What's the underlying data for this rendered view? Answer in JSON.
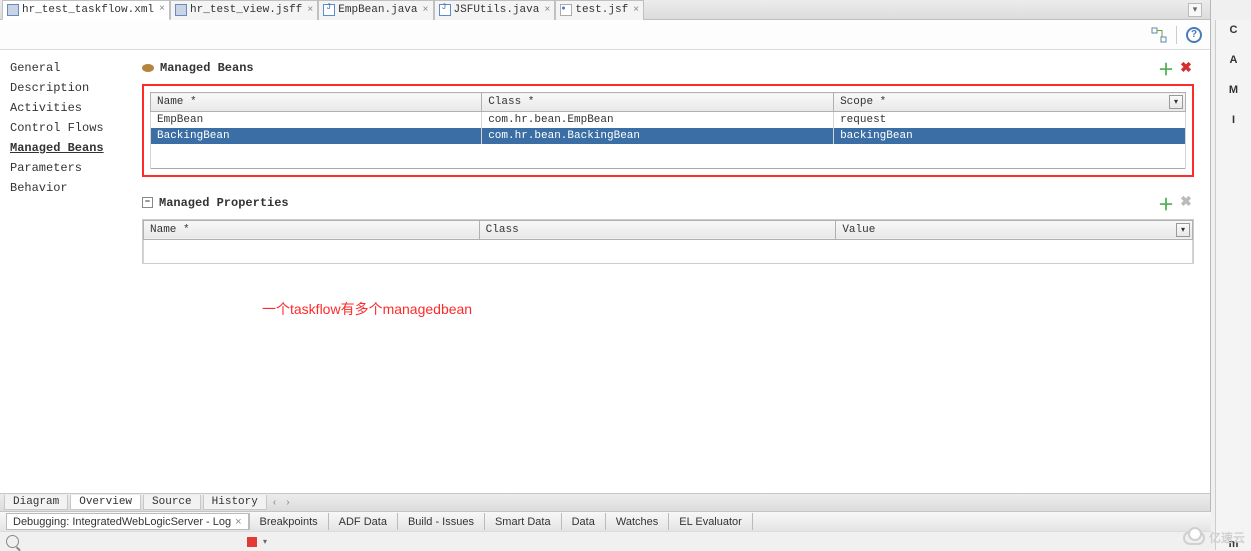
{
  "editorTabs": [
    {
      "label": "hr_test_taskflow.xml",
      "type": "xml",
      "active": true
    },
    {
      "label": "hr_test_view.jsff",
      "type": "xml",
      "active": false
    },
    {
      "label": "EmpBean.java",
      "type": "java",
      "active": false
    },
    {
      "label": "JSFUtils.java",
      "type": "java",
      "active": false
    },
    {
      "label": "test.jsf",
      "type": "jsf",
      "active": false
    }
  ],
  "sidebar": {
    "items": [
      {
        "label": "General"
      },
      {
        "label": "Description"
      },
      {
        "label": "Activities"
      },
      {
        "label": "Control Flows"
      },
      {
        "label": "Managed Beans",
        "selected": true
      },
      {
        "label": "Parameters"
      },
      {
        "label": "Behavior"
      }
    ]
  },
  "managedBeans": {
    "title": "Managed Beans",
    "headers": {
      "name": "Name *",
      "class": "Class *",
      "scope": "Scope *"
    },
    "rows": [
      {
        "name": "EmpBean",
        "class": "com.hr.bean.EmpBean",
        "scope": "request",
        "selected": false
      },
      {
        "name": "BackingBean",
        "class": "com.hr.bean.BackingBean",
        "scope": "backingBean",
        "selected": true
      }
    ]
  },
  "managedProperties": {
    "title": "Managed Properties",
    "headers": {
      "name": "Name *",
      "class": "Class",
      "value": "Value"
    }
  },
  "annotation": "一个taskflow有多个managedbean",
  "bottomTabs": [
    {
      "label": "Diagram"
    },
    {
      "label": "Overview",
      "active": true
    },
    {
      "label": "Source"
    },
    {
      "label": "History"
    }
  ],
  "debugBar": {
    "main": "Debugging: IntegratedWebLogicServer - Log",
    "tabs": [
      "Breakpoints",
      "ADF Data",
      "Build - Issues",
      "Smart Data",
      "Data",
      "Watches",
      "EL Evaluator"
    ]
  },
  "rightStrip": [
    "C",
    "A",
    "M",
    "I",
    "m"
  ],
  "watermark": "亿速云"
}
